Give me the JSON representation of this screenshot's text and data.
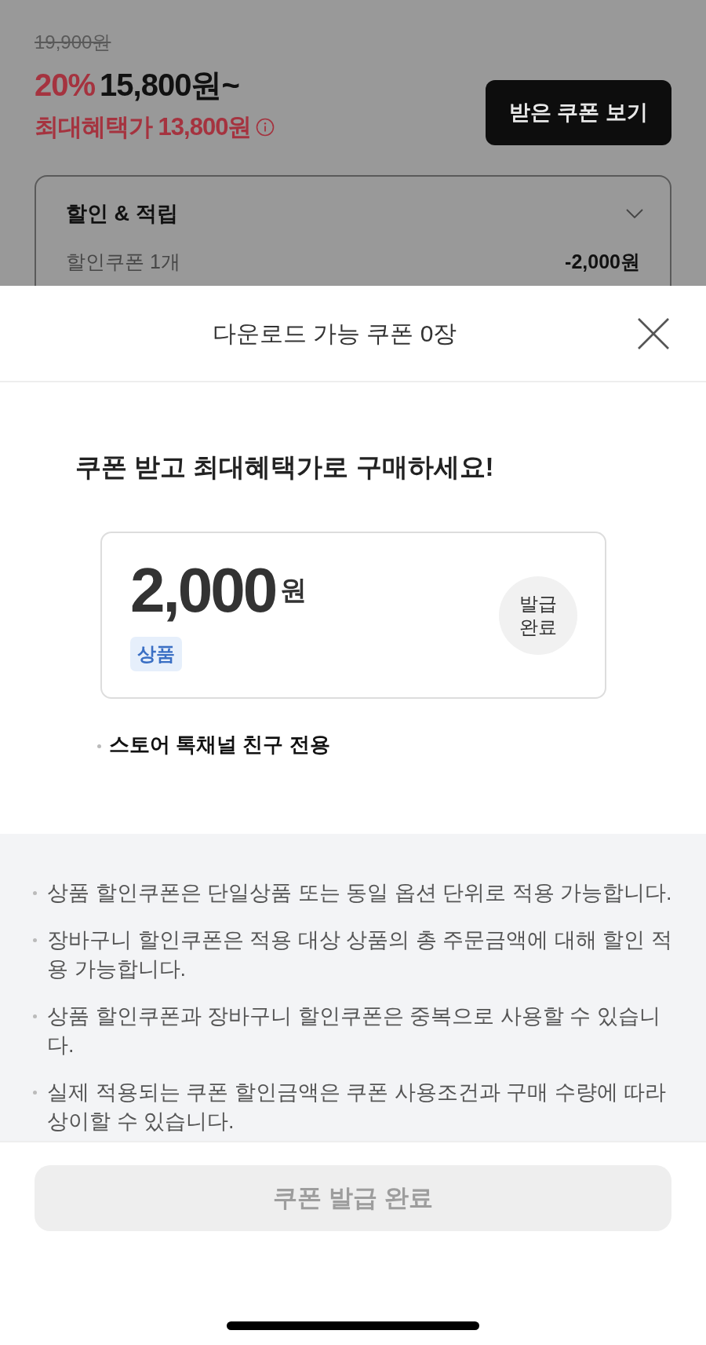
{
  "product": {
    "original_price": "19,900원",
    "discount_rate": "20%",
    "sale_price": "15,800원~",
    "max_benefit_price": "최대혜택가 13,800원",
    "received_coupons_button": "받은 쿠폰 보기"
  },
  "benefits_panel": {
    "title": "할인 & 적립",
    "rows": [
      {
        "label": "할인쿠폰 1개",
        "value": "-2,000원"
      }
    ]
  },
  "sheet": {
    "title": "다운로드 가능 쿠폰 0장",
    "headline": "쿠폰 받고 최대혜택가로 구매하세요!",
    "coupons": [
      {
        "amount": "2,000",
        "unit": "원",
        "tag": "상품",
        "status": "발급 완료",
        "issued": true,
        "conditions": [
          "스토어 톡채널 친구 전용"
        ]
      }
    ],
    "notes": [
      "상품 할인쿠폰은 단일상품 또는 동일 옵션 단위로 적용 가능합니다.",
      "장바구니 할인쿠폰은 적용 대상 상품의 총 주문금액에 대해 할인 적용 가능합니다.",
      "상품 할인쿠폰과 장바구니 할인쿠폰은 중복으로 사용할 수 있습니다.",
      "실제 적용되는 쿠폰 할인금액은 쿠폰 사용조건과 구매 수량에 따라 상이할 수 있습니다."
    ],
    "action_button": {
      "label": "쿠폰 발급 완료",
      "disabled": true
    }
  }
}
